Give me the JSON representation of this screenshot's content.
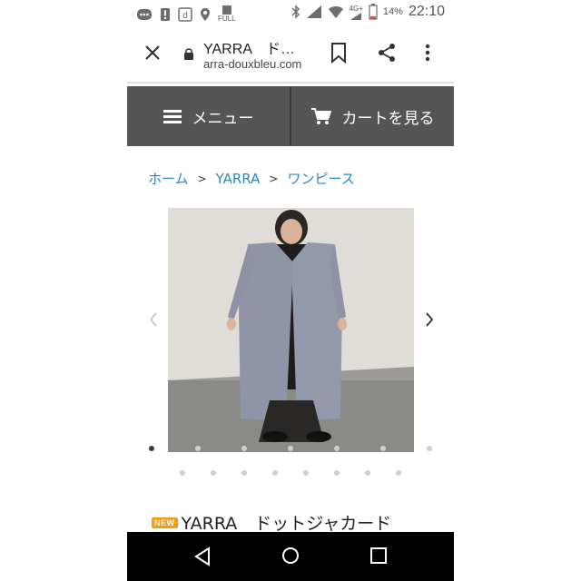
{
  "status_bar": {
    "time": "22:10",
    "battery_percent": "14%",
    "network_label": "4G+",
    "full_label": "FULL",
    "icons": [
      "message-icon",
      "alert-icon",
      "docomo-icon",
      "location-icon",
      "sim-full-icon",
      "bluetooth-icon",
      "signal-icon",
      "wifi-icon",
      "network-4g-icon",
      "battery-icon"
    ]
  },
  "browser": {
    "page_title": "YARRA　ド…",
    "domain": "arra-douxbleu.com",
    "icons": [
      "close-icon",
      "lock-icon",
      "bookmark-icon",
      "share-icon",
      "more-vert-icon"
    ]
  },
  "site_nav": {
    "menu_label": "メニュー",
    "cart_label": "カートを見る",
    "icons": [
      "hamburger-icon",
      "cart-icon"
    ]
  },
  "breadcrumb": {
    "items": [
      "ホーム",
      "YARRA",
      "ワンピース"
    ],
    "separator": ">"
  },
  "gallery": {
    "total_images": 15,
    "active_index": 0,
    "icons": [
      "chevron-left-icon",
      "chevron-right-icon"
    ]
  },
  "product": {
    "badge": "NEW",
    "title": "YARRA　ドットジャカード"
  },
  "colors": {
    "nav_bg": "#555555",
    "link": "#2e86c1",
    "badge": "#f39c12"
  },
  "android_nav": {
    "icons": [
      "back-icon",
      "home-icon",
      "recent-apps-icon"
    ]
  }
}
